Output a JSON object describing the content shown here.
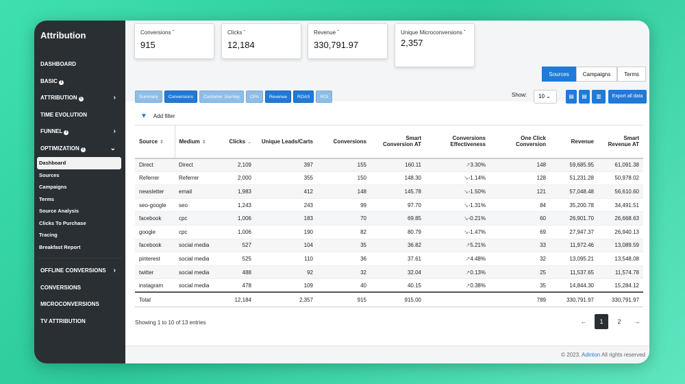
{
  "app": {
    "title": "Attribution"
  },
  "sidebar": {
    "items": [
      {
        "label": "DASHBOARD"
      },
      {
        "label": "BASIC",
        "info": true
      },
      {
        "label": "ATTRIBUTION",
        "info": true,
        "chevron": "›"
      },
      {
        "label": "TIME EVOLUTION"
      },
      {
        "label": "FUNNEL",
        "info": true,
        "chevron": "›"
      },
      {
        "label": "OPTIMIZATION",
        "info": true,
        "chevron": "⌄"
      }
    ],
    "sub_items": [
      {
        "label": "Dashboard"
      },
      {
        "label": "Sources"
      },
      {
        "label": "Campaigns"
      },
      {
        "label": "Terms"
      },
      {
        "label": "Source Analysis"
      },
      {
        "label": "Clicks To Purchase"
      },
      {
        "label": "Tracing"
      },
      {
        "label": "Breakfast Report"
      }
    ],
    "bottom_items": [
      {
        "label": "OFFLINE CONVERSIONS",
        "chevron": "›"
      },
      {
        "label": "CONVERSIONS"
      },
      {
        "label": "MICROCONVERSIONS"
      },
      {
        "label": "TV ATTRIBUTION"
      }
    ]
  },
  "kpis": [
    {
      "label": "Conversions ˇ",
      "value": "915"
    },
    {
      "label": "Clicks ˇ",
      "value": "12,184"
    },
    {
      "label": "Revenue ˇ",
      "value": "330,791.97"
    },
    {
      "label": "Unique Microconversions ˇ",
      "value": "2,357"
    }
  ],
  "view_toggle": [
    "Sources",
    "Campaigns",
    "Terms"
  ],
  "tabs": [
    "Summary",
    "Conversions",
    "Customer Journey",
    "CPA",
    "Revenue",
    "ROAS",
    "ROI"
  ],
  "show": {
    "label": "Show:",
    "value": "10"
  },
  "export_label": "Export all data",
  "filter_label": "Add filter",
  "table": {
    "headers": [
      "Source",
      "Medium",
      "Clicks",
      "Unique Leads/Carts",
      "Conversions",
      "Smart Conversion AT",
      "Conversions Effectiveness",
      "One Click Conversion",
      "Revenue",
      "Smart Revenue AT"
    ],
    "rows": [
      [
        "Direct",
        "Direct",
        "2,109",
        "397",
        "155",
        "160.11",
        "3.30%",
        "148",
        "59,685.95",
        "61,091.38"
      ],
      [
        "Referrer",
        "Referrer",
        "2,000",
        "355",
        "150",
        "148.30",
        "-1.14%",
        "128",
        "51,231.28",
        "50,978.02"
      ],
      [
        "newsletter",
        "email",
        "1,983",
        "412",
        "148",
        "145.78",
        "-1.50%",
        "121",
        "57,048.48",
        "56,610.60"
      ],
      [
        "seo-google",
        "seo",
        "1,243",
        "243",
        "99",
        "97.70",
        "-1.31%",
        "84",
        "35,200.78",
        "34,491.51"
      ],
      [
        "facebook",
        "cpc",
        "1,006",
        "183",
        "70",
        "69.85",
        "-0.21%",
        "60",
        "26,901.70",
        "26,668.63"
      ],
      [
        "google",
        "cpc",
        "1,006",
        "190",
        "82",
        "80.79",
        "-1.47%",
        "69",
        "27,947.37",
        "26,940.13"
      ],
      [
        "facebook",
        "social media",
        "527",
        "104",
        "35",
        "36.82",
        "5.21%",
        "33",
        "11,972.46",
        "13,089.59"
      ],
      [
        "pinterest",
        "social media",
        "525",
        "110",
        "36",
        "37.61",
        "4.48%",
        "32",
        "13,095.21",
        "13,548.08"
      ],
      [
        "twitter",
        "social media",
        "488",
        "92",
        "32",
        "32.04",
        "0.13%",
        "25",
        "11,537.65",
        "11,574.78"
      ],
      [
        "instagram",
        "social media",
        "478",
        "109",
        "40",
        "40.15",
        "0.38%",
        "35",
        "14,844.30",
        "15,284.12"
      ]
    ],
    "trend_up": [
      true,
      false,
      false,
      false,
      false,
      false,
      true,
      true,
      true,
      true
    ],
    "total": [
      "Total",
      "",
      "12,184",
      "2,357",
      "915",
      "915.00",
      "",
      "789",
      "330,791.97",
      "330,791.97"
    ]
  },
  "entries_text": "Showing 1 to 10 of 13 entries",
  "pager": {
    "prev": "←",
    "pages": [
      "1",
      "2"
    ],
    "next": "→"
  },
  "footer": {
    "prefix": "© 2023.",
    "brand": "Adinton",
    "suffix": "All rights reserved"
  }
}
